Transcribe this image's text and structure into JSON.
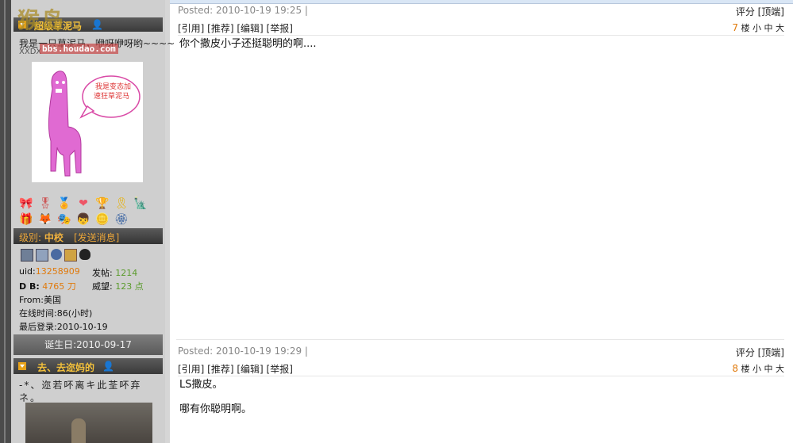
{
  "watermark": {
    "logo_text": "猴岛",
    "url": "bbs.houdao.com"
  },
  "user1": {
    "title": "超级草泥马",
    "person_icon": "user-icon",
    "signature_line1": "我是一只草泥马，咿呀咿呀哟~~~~",
    "signature_line2": "XXDX",
    "avatar_speech": "我是变态加速狂草泥马",
    "level_label": "级别:",
    "level_value": "中校",
    "send_message": "[发送消息]",
    "stats": {
      "uid_label": "uid:",
      "uid": "13258909",
      "posts_label": "发帖:",
      "posts": "1214",
      "db_label": "D B:",
      "db_value": "4765 刀",
      "prestige_label": "威望:",
      "prestige": "123 点",
      "from": "From:美国",
      "online": "在线时间:86(小时)",
      "last_login": "最后登录:2010-10-19"
    },
    "birthday": "诞生日:2010-09-17"
  },
  "user2": {
    "title": "去、去迩妈的",
    "person_icon": "user-icon",
    "signature": "-*、迩若吥离キ此荃吥弃ネ。"
  },
  "posts": [
    {
      "posted": "Posted: 2010-10-19 19:25 |",
      "rate": "评分 [顶端]",
      "actions": "[引用] [推荐] [编辑] [举报]",
      "floor_num": "7",
      "floor_label": "楼",
      "font_sizes": "小 中 大",
      "content": [
        "你个撒皮小子还挺聪明的啊...."
      ]
    },
    {
      "posted": "Posted: 2010-10-19 19:29 |",
      "rate": "评分 [顶端]",
      "actions": "[引用] [推荐] [编辑] [举报]",
      "floor_num": "8",
      "floor_label": "楼",
      "font_sizes": "小 中 大",
      "content": [
        "LS撒皮。",
        "哪有你聪明啊。"
      ]
    }
  ],
  "colors": {
    "accent": "#e07a0c",
    "header_bg": "#3a3a3a",
    "title_gold": "#f5c23b"
  }
}
